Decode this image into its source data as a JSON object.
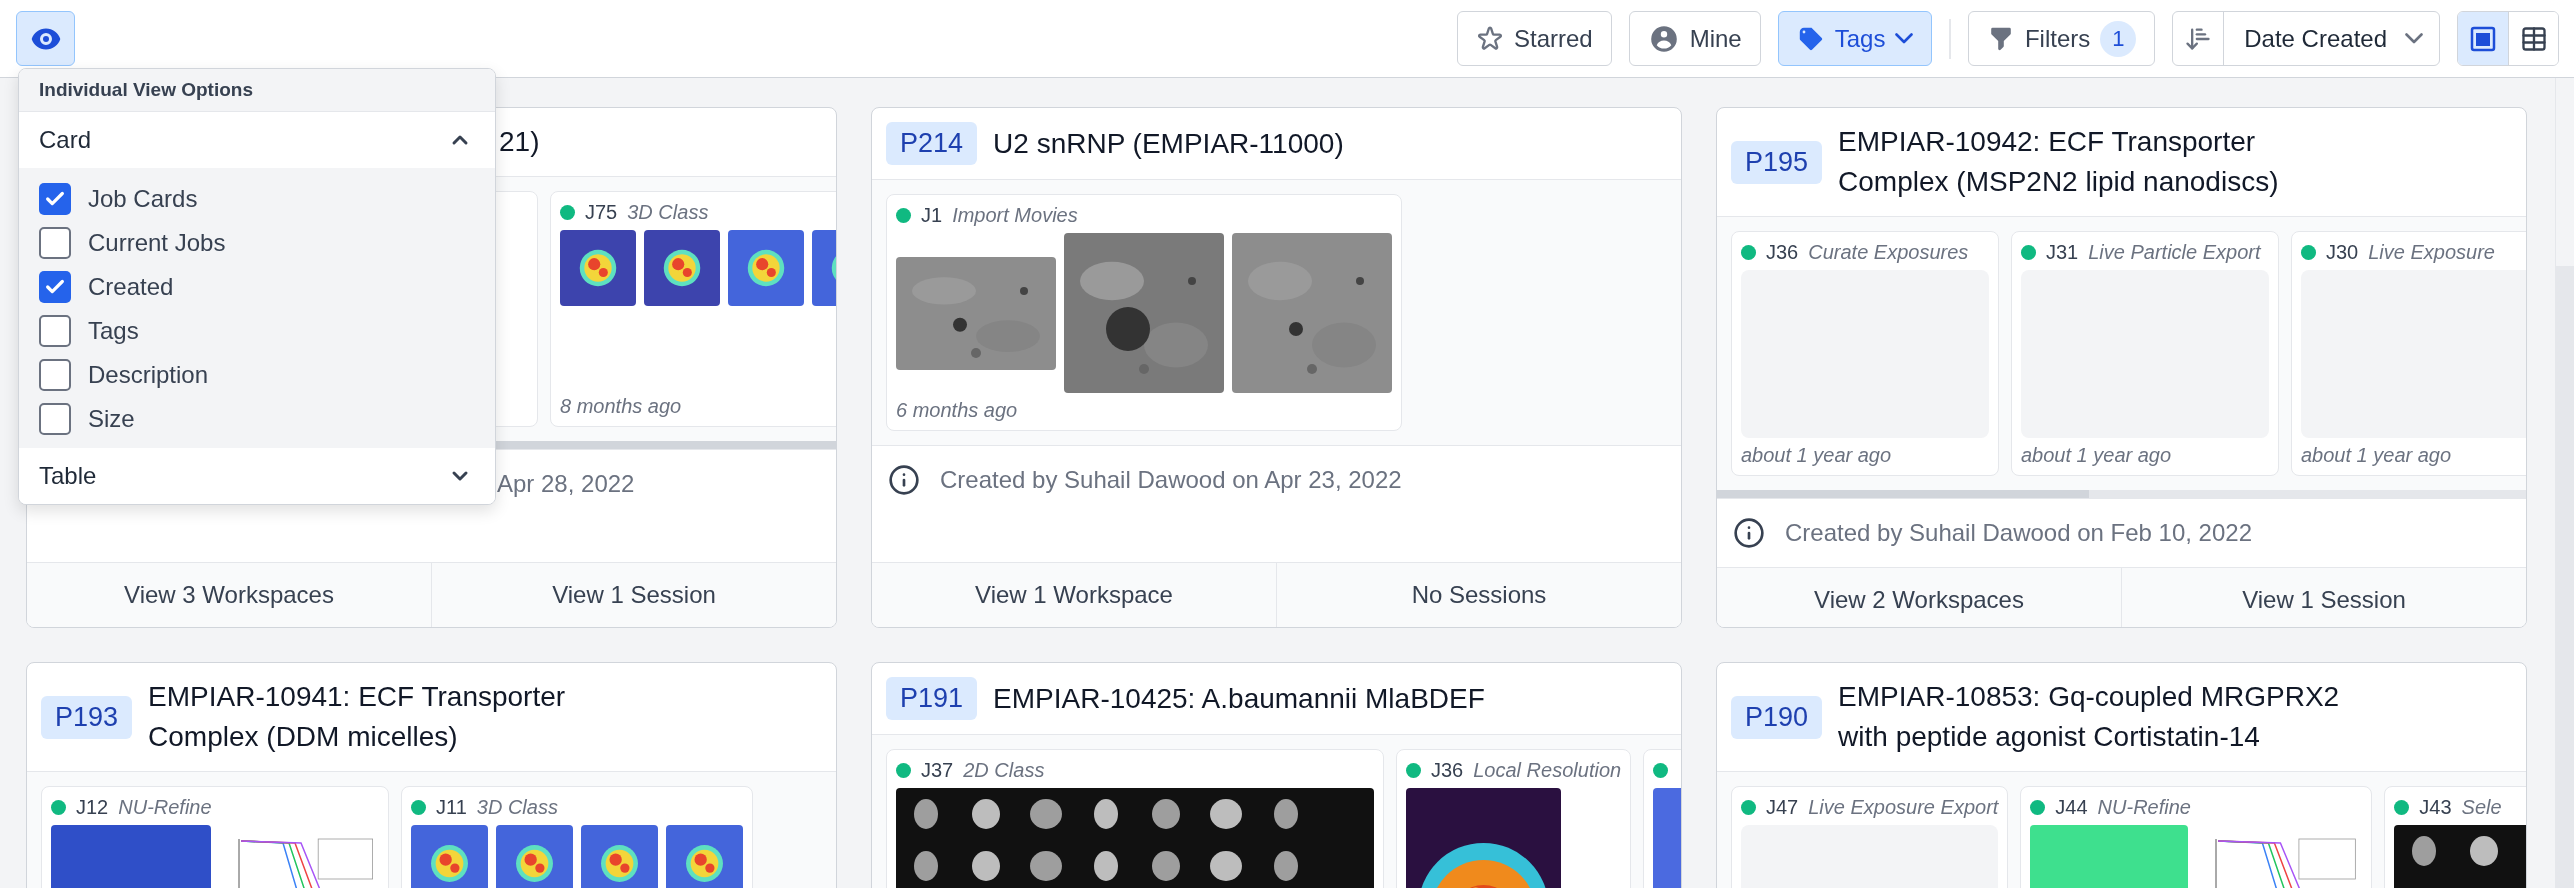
{
  "toolbar": {
    "view_options": {
      "selected": true
    },
    "filters": [
      {
        "kind": "star",
        "label": "Starred",
        "selected": false
      },
      {
        "kind": "user",
        "label": "Mine",
        "selected": false
      },
      {
        "kind": "tag",
        "label": "Tags",
        "selected": true
      }
    ],
    "filters_button": {
      "label": "Filters",
      "count": "1"
    },
    "sort": {
      "value": "Date Created"
    },
    "view_modes": [
      {
        "kind": "card",
        "selected": true
      },
      {
        "kind": "table",
        "selected": false
      }
    ]
  },
  "view_options": {
    "title": "Individual View Options",
    "sections": [
      {
        "label": "Card",
        "expanded": true,
        "options": [
          {
            "label": "Job Cards",
            "checked": true
          },
          {
            "label": "Current Jobs",
            "checked": false
          },
          {
            "label": "Created",
            "checked": true
          },
          {
            "label": "Tags",
            "checked": false
          },
          {
            "label": "Description",
            "checked": false
          },
          {
            "label": "Size",
            "checked": false
          }
        ]
      },
      {
        "label": "Table",
        "expanded": false
      }
    ]
  },
  "projects": [
    {
      "kind": "covered",
      "title": "21)",
      "scrollable": true,
      "jobs": [
        {
          "kind": "covered"
        },
        {
          "kind": "job",
          "color": "#10b981",
          "id": "J75",
          "type": "3D Class",
          "age": "8 months ago"
        }
      ],
      "created": "Apr 28, 2022",
      "actions": [
        "View 3 Workspaces",
        "View 1 Session"
      ]
    },
    {
      "kind": "full",
      "badge": "P214",
      "title": "U2 snRNP (EMPIAR-11000)",
      "scrollable": false,
      "jobs": [
        {
          "kind": "job",
          "color": "#10b981",
          "id": "J1",
          "type": "Import Movies",
          "age": "6 months ago"
        }
      ],
      "created": "Created by Suhail Dawood on Apr 23, 2022",
      "actions": [
        "View 1 Workspace",
        "No Sessions"
      ]
    },
    {
      "kind": "full",
      "badge": "P195",
      "title": "EMPIAR-10942: ECF Transporter Complex (MSP2N2 lipid nanodiscs)",
      "scrollable": true,
      "jobs": [
        {
          "kind": "job",
          "color": "#10b981",
          "id": "J36",
          "type": "Curate Exposures",
          "images": [
            {
              "kind": "placeholder"
            }
          ],
          "age": "about 1 year ago"
        },
        {
          "kind": "job",
          "color": "#10b981",
          "id": "J31",
          "type": "Live Particle Export",
          "images": [
            {
              "kind": "placeholder"
            }
          ],
          "age": "about 1 year ago"
        },
        {
          "kind": "job",
          "color": "#10b981",
          "id": "J30",
          "type": "Live Exposure",
          "images": [
            {
              "kind": "placeholder"
            }
          ],
          "age": "about 1 year ago"
        }
      ],
      "created": "Created by Suhail Dawood on Feb 10, 2022",
      "actions": [
        "View 2 Workspaces",
        "View 1 Session"
      ]
    },
    {
      "kind": "full",
      "badge": "P193",
      "title": "EMPIAR-10941: ECF Transporter Complex (DDM micelles)",
      "jobs": [
        {
          "kind": "job",
          "color": "#10b981",
          "id": "J12",
          "type": "NU-Refine"
        },
        {
          "kind": "job",
          "color": "#10b981",
          "id": "J11",
          "type": "3D Class"
        }
      ]
    },
    {
      "kind": "full",
      "badge": "P191",
      "title": "EMPIAR-10425: A.baumannii MlaBDEF",
      "jobs": [
        {
          "kind": "job",
          "color": "#10b981",
          "id": "J37",
          "type": "2D Class"
        },
        {
          "kind": "job",
          "color": "#10b981",
          "id": "J36",
          "type": "Local Resolution"
        },
        {
          "kind": "job",
          "color": "#10b981"
        }
      ]
    },
    {
      "kind": "full",
      "badge": "P190",
      "title": "EMPIAR-10853: Gq-coupled MRGPRX2 with peptide agonist Cortistatin-14",
      "jobs": [
        {
          "kind": "job",
          "color": "#10b981",
          "id": "J47",
          "type": "Live Exposure Export",
          "images": [
            {
              "kind": "placeholder"
            }
          ]
        },
        {
          "kind": "job",
          "color": "#10b981",
          "id": "J44",
          "type": "NU-Refine"
        },
        {
          "kind": "job",
          "color": "#10b981",
          "id": "J43",
          "type": "Sele"
        }
      ]
    }
  ]
}
